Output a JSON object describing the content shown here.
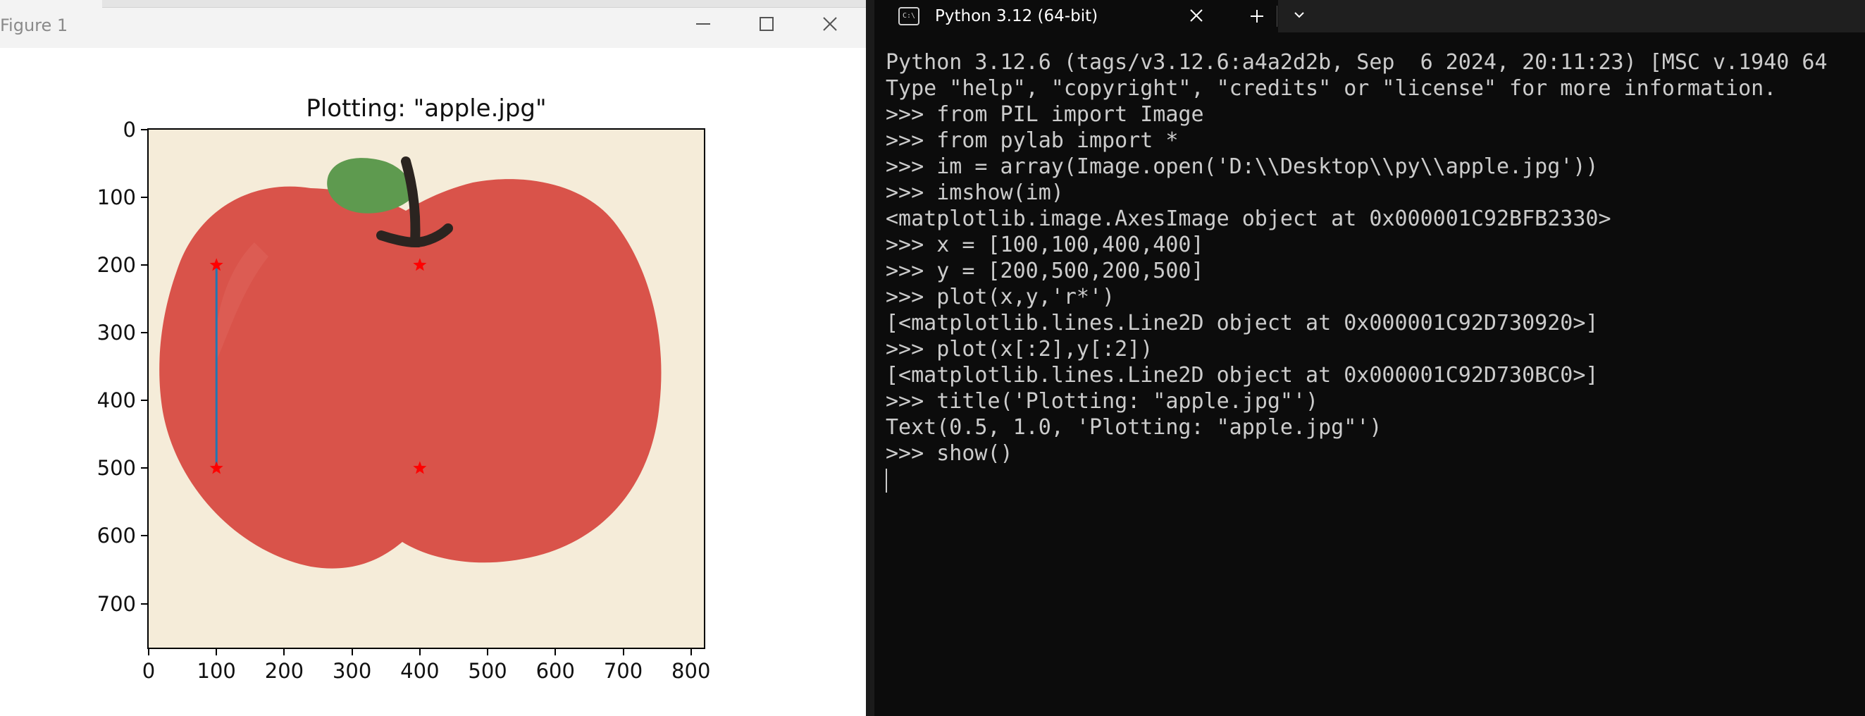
{
  "figure": {
    "window_title": "Figure 1",
    "minimize_icon": "minimize-icon",
    "maximize_icon": "maximize-icon",
    "close_icon": "close-icon",
    "plot_title": "Plotting: \"apple.jpg\""
  },
  "chart_data": {
    "type": "scatter",
    "title": "Plotting: \"apple.jpg\"",
    "xlabel": "",
    "ylabel": "",
    "xlim": [
      0,
      819
    ],
    "ylim": [
      765,
      0
    ],
    "y_inverted": true,
    "image": "apple.jpg",
    "x_ticks": [
      "0",
      "100",
      "200",
      "300",
      "400",
      "500",
      "600",
      "700",
      "800"
    ],
    "y_ticks": [
      "0",
      "100",
      "200",
      "300",
      "400",
      "500",
      "600",
      "700"
    ],
    "x_tick_values": [
      0,
      100,
      200,
      300,
      400,
      500,
      600,
      700,
      800
    ],
    "y_tick_values": [
      0,
      100,
      200,
      300,
      400,
      500,
      600,
      700
    ],
    "series": [
      {
        "style": "r*",
        "color": "#ff0000",
        "marker": "star",
        "x": [
          100,
          100,
          400,
          400
        ],
        "y": [
          200,
          500,
          200,
          500
        ]
      },
      {
        "style": "line",
        "color": "#1f77b4",
        "x": [
          100,
          100
        ],
        "y": [
          200,
          500
        ]
      }
    ]
  },
  "terminal": {
    "tab_title": "Python 3.12 (64-bit)",
    "tab_icon": "terminal-icon",
    "close_tab_icon": "close-icon",
    "new_tab_icon": "plus-icon",
    "dropdown_icon": "chevron-down-icon",
    "lines": [
      "Python 3.12.6 (tags/v3.12.6:a4a2d2b, Sep  6 2024, 20:11:23) [MSC v.1940 64",
      "Type \"help\", \"copyright\", \"credits\" or \"license\" for more information.",
      ">>> from PIL import Image",
      ">>> from pylab import *",
      ">>> im = array(Image.open('D:\\\\Desktop\\\\py\\\\apple.jpg'))",
      ">>> imshow(im)",
      "<matplotlib.image.AxesImage object at 0x000001C92BFB2330>",
      ">>> x = [100,100,400,400]",
      ">>> y = [200,500,200,500]",
      ">>> plot(x,y,'r*')",
      "[<matplotlib.lines.Line2D object at 0x000001C92D730920>]",
      ">>> plot(x[:2],y[:2])",
      "[<matplotlib.lines.Line2D object at 0x000001C92D730BC0>]",
      ">>> title('Plotting: \"apple.jpg\"')",
      "Text(0.5, 1.0, 'Plotting: \"apple.jpg\"')",
      ">>> show()"
    ]
  }
}
